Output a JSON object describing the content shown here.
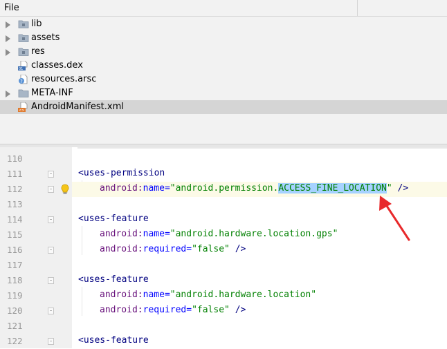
{
  "header": {
    "column_file": "File"
  },
  "tree": [
    {
      "label": "lib",
      "type": "folder",
      "expandable": true
    },
    {
      "label": "assets",
      "type": "folder",
      "expandable": true
    },
    {
      "label": "res",
      "type": "folder",
      "expandable": true
    },
    {
      "label": "classes.dex",
      "type": "dex",
      "expandable": false
    },
    {
      "label": "resources.arsc",
      "type": "arsc",
      "expandable": false
    },
    {
      "label": "META-INF",
      "type": "folder",
      "expandable": true
    },
    {
      "label": "AndroidManifest.xml",
      "type": "xml",
      "expandable": false,
      "selected": true
    }
  ],
  "editor": {
    "lines": [
      {
        "num": "110"
      },
      {
        "num": "111",
        "fold": true,
        "tag": "<uses-permission"
      },
      {
        "num": "112",
        "fold": true,
        "bulb": true,
        "current": true,
        "ns": "android",
        "attr": "name",
        "eq": "=",
        "q1": "\"",
        "value_pre": "android.permission.",
        "value_sel": "ACCESS_FINE_LOCATION",
        "q2": "\"",
        "tail": " />"
      },
      {
        "num": "113"
      },
      {
        "num": "114",
        "fold": true,
        "tag": "<uses-feature"
      },
      {
        "num": "115",
        "ns": "android",
        "attr": "name",
        "eq": "=",
        "value": "\"android.hardware.location.gps\""
      },
      {
        "num": "116",
        "fold": true,
        "ns": "android",
        "attr": "required",
        "eq": "=",
        "value": "\"false\"",
        "tail": " />"
      },
      {
        "num": "117"
      },
      {
        "num": "118",
        "fold": true,
        "tag": "<uses-feature"
      },
      {
        "num": "119",
        "ns": "android",
        "attr": "name",
        "eq": "=",
        "value": "\"android.hardware.location\""
      },
      {
        "num": "120",
        "fold": true,
        "ns": "android",
        "attr": "required",
        "eq": "=",
        "value": "\"false\"",
        "tail": " />"
      },
      {
        "num": "121"
      },
      {
        "num": "122",
        "fold": true,
        "tag": "<uses-feature"
      }
    ]
  },
  "colors": {
    "tag": "#000080",
    "namespace": "#660e7a",
    "attribute": "#0000ff",
    "string": "#008000",
    "selection": "#a6d2ff",
    "annotation_arrow": "#e8292b"
  },
  "icons": {
    "folder": "folder-icon",
    "dex": "dex-file-icon",
    "arsc": "arsc-file-icon",
    "xml": "xml-file-icon",
    "bulb": "lightbulb-icon",
    "expand": "chevron-right-icon"
  }
}
